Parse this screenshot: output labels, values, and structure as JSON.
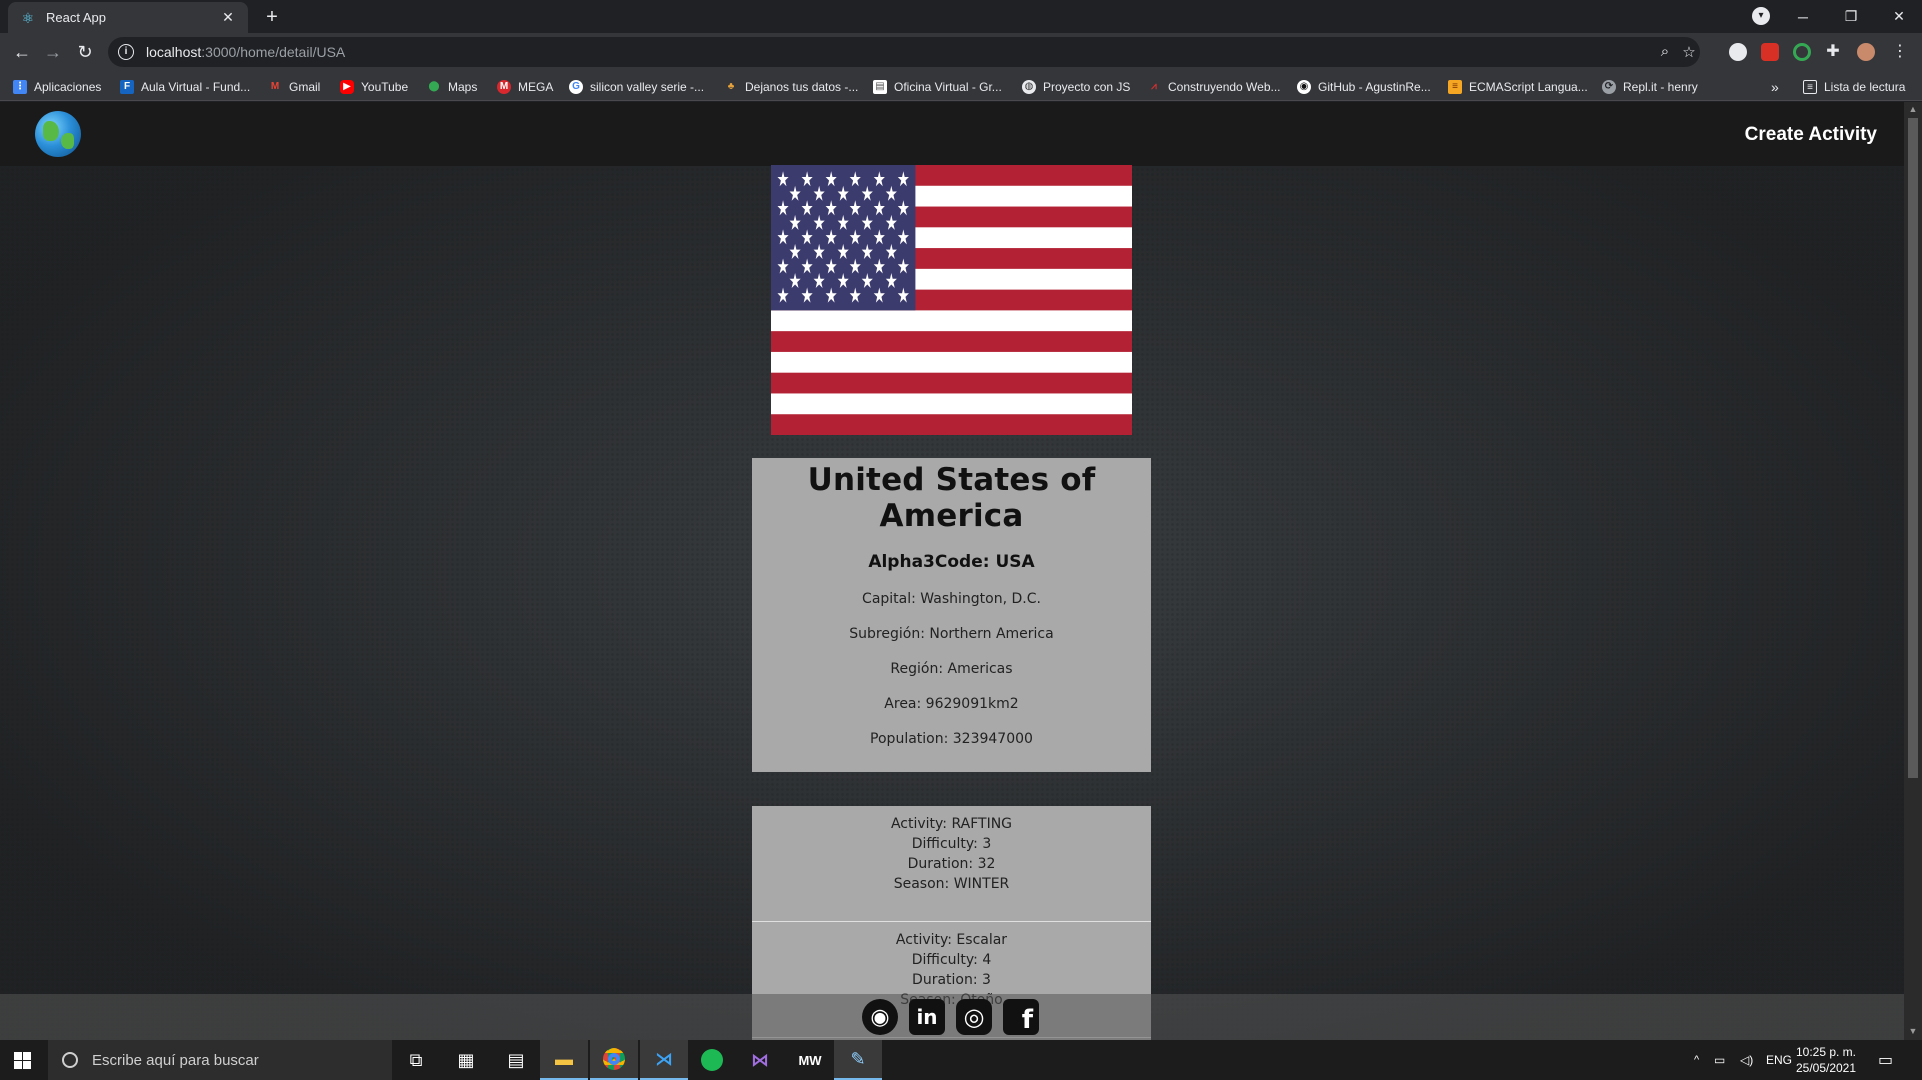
{
  "browser": {
    "tab_title": "React App",
    "new_tab": "+",
    "url_host": "localhost",
    "url_path": ":3000/home/detail/USA",
    "window_controls": {
      "minimize": "─",
      "restore": "❐",
      "close": "✕"
    }
  },
  "bookmarks": [
    {
      "label": "Aplicaciones",
      "icon": "apps-grid-icon",
      "color": "#4285f4"
    },
    {
      "label": "Aula Virtual - Fund...",
      "icon": "fu-icon",
      "color": "#1565c0"
    },
    {
      "label": "Gmail",
      "icon": "gmail-icon",
      "color": "#ea4335"
    },
    {
      "label": "YouTube",
      "icon": "youtube-icon",
      "color": "#ff0000"
    },
    {
      "label": "Maps",
      "icon": "maps-icon",
      "color": "#34a853"
    },
    {
      "label": "MEGA",
      "icon": "mega-icon",
      "color": "#d9272e"
    },
    {
      "label": "silicon valley serie -...",
      "icon": "google-icon",
      "color": "#ffffff"
    },
    {
      "label": "Dejanos tus datos -...",
      "icon": "people-icon",
      "color": "#e8a33d"
    },
    {
      "label": "Oficina Virtual - Gr...",
      "icon": "doc-icon",
      "color": "#ffffff"
    },
    {
      "label": "Proyecto con JS",
      "icon": "globe-icon",
      "color": "#e8eaed"
    },
    {
      "label": "Construyendo Web...",
      "icon": "wave-icon",
      "color": "#d32f2f"
    },
    {
      "label": "GitHub - AgustinRe...",
      "icon": "github-icon",
      "color": "#ffffff"
    },
    {
      "label": "ECMAScript Langua...",
      "icon": "ecma-icon",
      "color": "#f5a623"
    },
    {
      "label": "Repl.it - henry",
      "icon": "replit-icon",
      "color": "#9aa0a6"
    }
  ],
  "bookmarks_more": "»",
  "reading_list": "Lista de lectura",
  "navbar": {
    "create_activity": "Create Activity"
  },
  "country": {
    "name": "United States of America",
    "alpha3": "Alpha3Code: USA",
    "capital": "Capital: Washington, D.C.",
    "subregion": "Subregión: Northern America",
    "region": "Región: Americas",
    "area": "Area: 9629091km2",
    "population": "Population: 323947000"
  },
  "activities": [
    {
      "name": "Activity: RAFTING",
      "difficulty": "Difficulty: 3",
      "duration": "Duration: 32",
      "season": "Season: WINTER"
    },
    {
      "name": "Activity: Escalar",
      "difficulty": "Difficulty: 4",
      "duration": "Duration: 3",
      "season": "Season: Otoño"
    }
  ],
  "footer": {
    "social": [
      {
        "name": "github",
        "glyph": "◉"
      },
      {
        "name": "linkedin",
        "glyph": "in"
      },
      {
        "name": "instagram",
        "glyph": "◎"
      },
      {
        "name": "facebook",
        "glyph": "f"
      }
    ]
  },
  "taskbar": {
    "search_placeholder": "Escribe aquí para buscar",
    "lang": "ENG",
    "time": "10:25 p. m.",
    "date": "25/05/2021"
  },
  "colors": {
    "flag_red": "#b22234",
    "flag_blue": "#3c3b6e",
    "card_bg": "#a9a9a9",
    "navbar_bg": "#1a1a1a",
    "taskbar_accent": "#76b9ed"
  }
}
